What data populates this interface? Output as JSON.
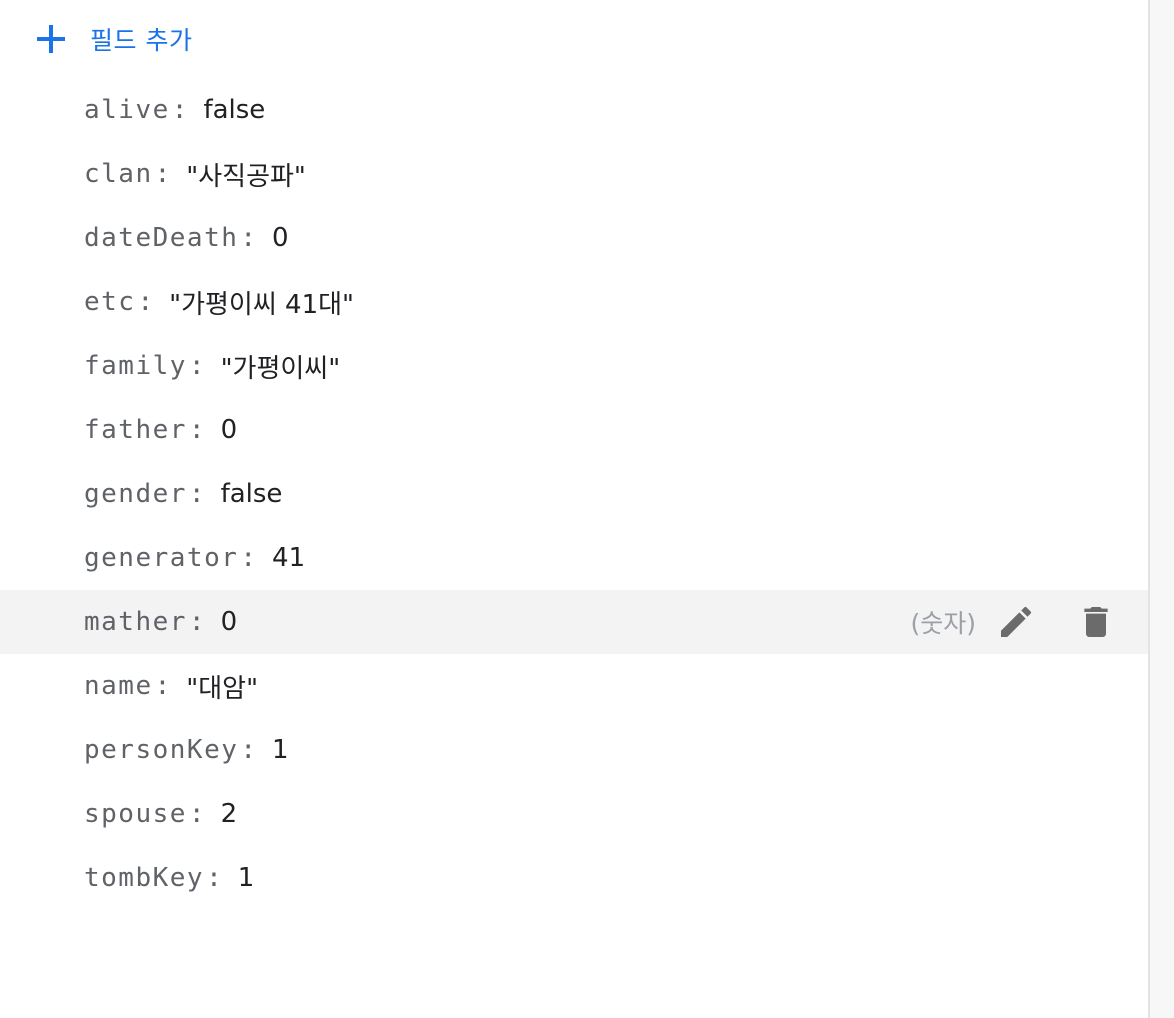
{
  "toolbar": {
    "add_field_label": "필드 추가",
    "add_icon": "plus-icon"
  },
  "fields": [
    {
      "key": "alive",
      "value": "false"
    },
    {
      "key": "clan",
      "value": "\"사직공파\""
    },
    {
      "key": "dateDeath",
      "value": "0"
    },
    {
      "key": "etc",
      "value": "\"가평이씨 41대\""
    },
    {
      "key": "family",
      "value": "\"가평이씨\""
    },
    {
      "key": "father",
      "value": "0"
    },
    {
      "key": "gender",
      "value": "false"
    },
    {
      "key": "generator",
      "value": "41"
    },
    {
      "key": "mather",
      "value": "0",
      "type_hint": "(숫자)",
      "edit_icon": "pencil-icon",
      "delete_icon": "trash-icon"
    },
    {
      "key": "name",
      "value": "\"대암\""
    },
    {
      "key": "personKey",
      "value": "1"
    },
    {
      "key": "spouse",
      "value": "2"
    },
    {
      "key": "tombKey",
      "value": "1"
    }
  ],
  "colors": {
    "accent": "#1a73e8",
    "key_text": "#5f6368",
    "value_text": "#202124",
    "hover_row": "#f3f3f3",
    "hint_text": "#9aa0a6",
    "icon": "#6b6b6b"
  }
}
